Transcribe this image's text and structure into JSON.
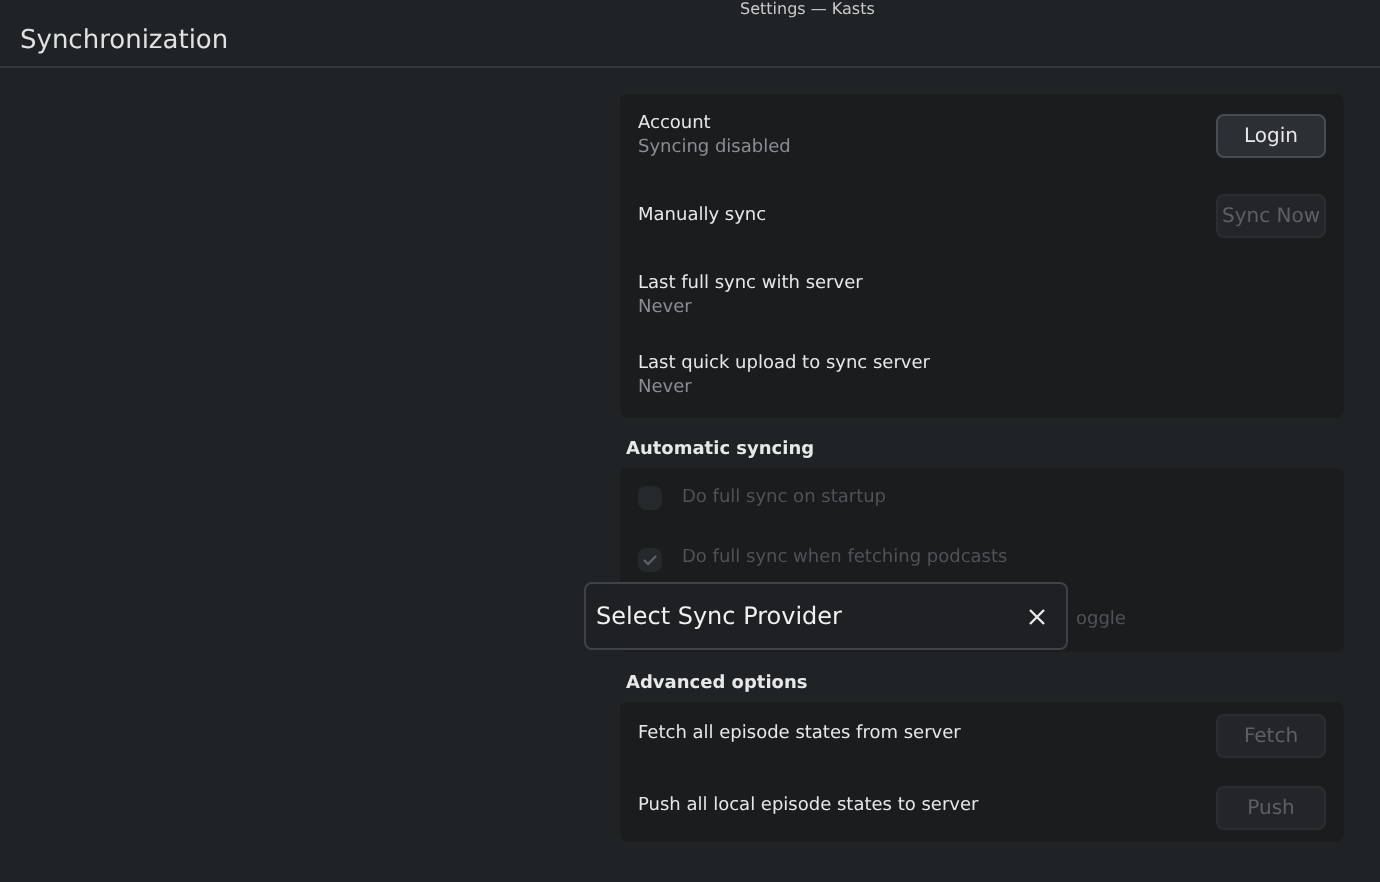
{
  "window": {
    "title": "Settings — Kasts"
  },
  "page_title": "Synchronization",
  "account_card": {
    "rows": [
      {
        "label": "Account",
        "sublabel": "Syncing disabled",
        "button": {
          "label": "Login",
          "disabled": false
        }
      },
      {
        "label": "Manually sync",
        "button": {
          "label": "Sync Now",
          "disabled": true
        }
      },
      {
        "label": "Last full sync with server",
        "sublabel": "Never"
      },
      {
        "label": "Last quick upload to sync server",
        "sublabel": "Never"
      }
    ]
  },
  "automatic_syncing": {
    "title": "Automatic syncing",
    "options": [
      {
        "label": "Do full sync on startup",
        "checked": false,
        "disabled": true,
        "covered": false
      },
      {
        "label": "Do full sync when fetching podcasts",
        "checked": true,
        "disabled": true,
        "covered": false
      },
      {
        "label": "oggle",
        "disabled": true,
        "covered": true
      }
    ]
  },
  "advanced_options": {
    "title": "Advanced options",
    "rows": [
      {
        "label": "Fetch all episode states from server",
        "button": {
          "label": "Fetch",
          "disabled": true
        }
      },
      {
        "label": "Push all local episode states to server",
        "button": {
          "label": "Push",
          "disabled": true
        }
      }
    ]
  },
  "dialog": {
    "title": "Select Sync Provider"
  }
}
